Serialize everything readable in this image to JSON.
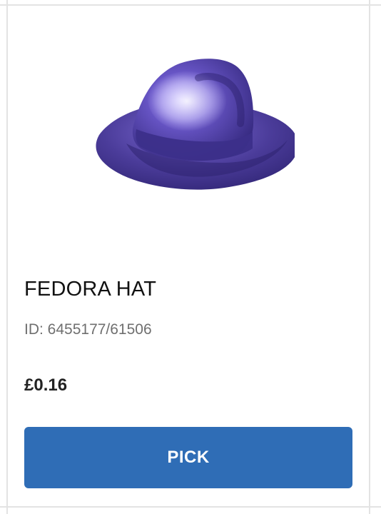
{
  "product": {
    "name": "FEDORA HAT",
    "id_text": "ID: 6455177/61506",
    "price": "£0.16",
    "image_icon": "fedora-hat-image",
    "image_color": "#4b3c9a"
  },
  "actions": {
    "pick_label": "PICK"
  },
  "colors": {
    "button_bg": "#2f6db6",
    "button_text": "#ffffff",
    "divider": "#e3e3e3"
  }
}
